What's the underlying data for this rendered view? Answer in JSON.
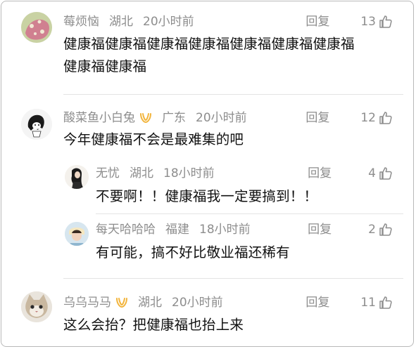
{
  "comments": [
    {
      "name": "莓烦恼",
      "location": "湖北",
      "time": "20小时前",
      "reply": "回复",
      "likes": "13",
      "text_lines": [
        "健康福健康福健康福健康福健康福健康福健康福",
        "健康福健康福"
      ]
    },
    {
      "name": "酸菜鱼小白兔",
      "location": "广东",
      "time": "20小时前",
      "reply": "回复",
      "likes": "12",
      "text_lines": [
        "今年健康福不会是最难集的吧"
      ],
      "replies": [
        {
          "name": "无忧",
          "location": "湖北",
          "time": "18小时前",
          "reply": "回复",
          "likes": "4",
          "text": "不要啊！！健康福我一定要搞到！！"
        },
        {
          "name": "每天哈哈哈",
          "location": "福建",
          "time": "18小时前",
          "reply": "回复",
          "likes": "2",
          "text": "有可能，搞不好比敬业福还稀有"
        }
      ]
    },
    {
      "name": "乌乌马马",
      "location": "湖北",
      "time": "20小时前",
      "reply": "回复",
      "likes": "11",
      "text_lines": [
        "这么会抬？把健康福也抬上来"
      ]
    }
  ],
  "icons": {
    "like": "thumbs-up-icon",
    "vip_badge": "vip-badge-icon"
  },
  "colors": {
    "meta_text": "#8d8d8d",
    "body_text": "#111111",
    "badge": "#f2b43b"
  }
}
